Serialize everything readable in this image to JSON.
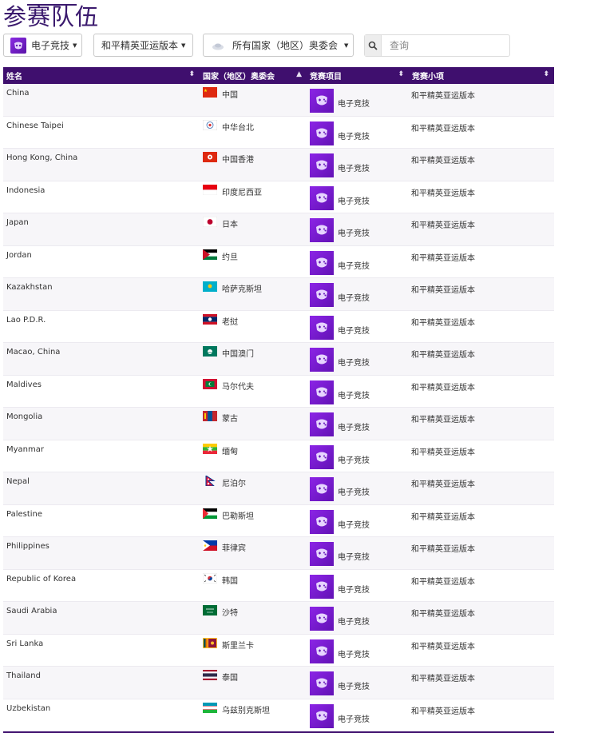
{
  "page": {
    "title": "参赛队伍"
  },
  "filters": {
    "sport": {
      "label": "电子竞技",
      "icon": "esports-icon"
    },
    "event": {
      "label": "和平精英亚运版本"
    },
    "noc": {
      "label": "所有国家（地区）奥委会",
      "icon": "globe-icon"
    },
    "search": {
      "placeholder": "查询",
      "icon": "search-icon"
    }
  },
  "table": {
    "columns": [
      {
        "label": "姓名"
      },
      {
        "label": "国家（地区）奥委会"
      },
      {
        "label": "竞赛项目"
      },
      {
        "label": "竞赛小项"
      }
    ],
    "rows": [
      {
        "name": "China",
        "noc": "中国",
        "flag": "china",
        "sport": "电子竞技",
        "event": "和平精英亚运版本"
      },
      {
        "name": "Chinese Taipei",
        "noc": "中华台北",
        "flag": "chinese-taipei",
        "sport": "电子竞技",
        "event": "和平精英亚运版本"
      },
      {
        "name": "Hong Kong, China",
        "noc": "中国香港",
        "flag": "hong-kong",
        "sport": "电子竞技",
        "event": "和平精英亚运版本"
      },
      {
        "name": "Indonesia",
        "noc": "印度尼西亚",
        "flag": "indonesia",
        "sport": "电子竞技",
        "event": "和平精英亚运版本"
      },
      {
        "name": "Japan",
        "noc": "日本",
        "flag": "japan",
        "sport": "电子竞技",
        "event": "和平精英亚运版本"
      },
      {
        "name": "Jordan",
        "noc": "约旦",
        "flag": "jordan",
        "sport": "电子竞技",
        "event": "和平精英亚运版本"
      },
      {
        "name": "Kazakhstan",
        "noc": "哈萨克斯坦",
        "flag": "kazakhstan",
        "sport": "电子竞技",
        "event": "和平精英亚运版本"
      },
      {
        "name": "Lao P.D.R.",
        "noc": "老挝",
        "flag": "laos",
        "sport": "电子竞技",
        "event": "和平精英亚运版本"
      },
      {
        "name": "Macao, China",
        "noc": "中国澳门",
        "flag": "macao",
        "sport": "电子竞技",
        "event": "和平精英亚运版本"
      },
      {
        "name": "Maldives",
        "noc": "马尔代夫",
        "flag": "maldives",
        "sport": "电子竞技",
        "event": "和平精英亚运版本"
      },
      {
        "name": "Mongolia",
        "noc": "蒙古",
        "flag": "mongolia",
        "sport": "电子竞技",
        "event": "和平精英亚运版本"
      },
      {
        "name": "Myanmar",
        "noc": "缅甸",
        "flag": "myanmar",
        "sport": "电子竞技",
        "event": "和平精英亚运版本"
      },
      {
        "name": "Nepal",
        "noc": "尼泊尔",
        "flag": "nepal",
        "sport": "电子竞技",
        "event": "和平精英亚运版本"
      },
      {
        "name": "Palestine",
        "noc": "巴勒斯坦",
        "flag": "palestine",
        "sport": "电子竞技",
        "event": "和平精英亚运版本"
      },
      {
        "name": "Philippines",
        "noc": "菲律宾",
        "flag": "philippines",
        "sport": "电子竞技",
        "event": "和平精英亚运版本"
      },
      {
        "name": "Republic of Korea",
        "noc": "韩国",
        "flag": "korea",
        "sport": "电子竞技",
        "event": "和平精英亚运版本"
      },
      {
        "name": "Saudi Arabia",
        "noc": "沙特",
        "flag": "saudi-arabia",
        "sport": "电子竞技",
        "event": "和平精英亚运版本"
      },
      {
        "name": "Sri Lanka",
        "noc": "斯里兰卡",
        "flag": "sri-lanka",
        "sport": "电子竞技",
        "event": "和平精英亚运版本"
      },
      {
        "name": "Thailand",
        "noc": "泰国",
        "flag": "thailand",
        "sport": "电子竞技",
        "event": "和平精英亚运版本"
      },
      {
        "name": "Uzbekistan",
        "noc": "乌兹别克斯坦",
        "flag": "uzbekistan",
        "sport": "电子竞技",
        "event": "和平精英亚运版本"
      }
    ]
  },
  "colors": {
    "header_bg": "#3f0f6e",
    "accent": "#7b22d6",
    "title": "#3b1a6e"
  }
}
